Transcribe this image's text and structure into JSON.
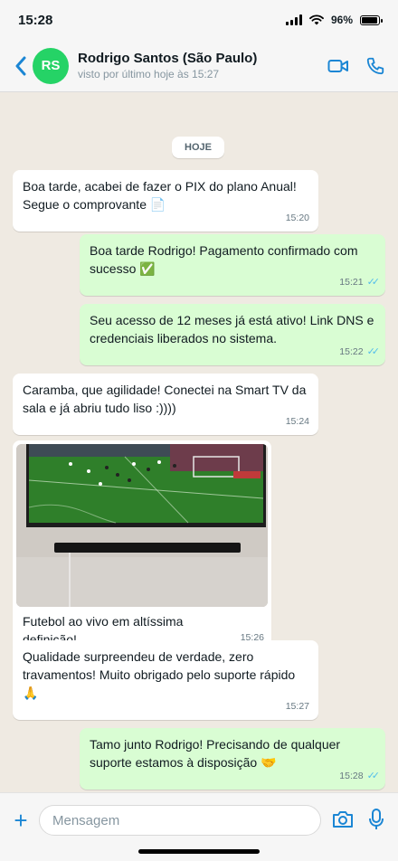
{
  "status": {
    "time": "15:28",
    "battery": "96%",
    "battery_level": 0.96
  },
  "header": {
    "avatar_initials": "RS",
    "contact_name": "Rodrigo Santos (São Paulo)",
    "contact_status": "visto por último hoje às 15:27",
    "accent": "#1b86d4"
  },
  "chat": {
    "date_label": "HOJE",
    "messages": [
      {
        "dir": "in",
        "text": "Boa tarde, acabei de fazer o PIX do plano Anual! Segue o comprovante 📄",
        "time": "15:20"
      },
      {
        "dir": "out",
        "text": "Boa tarde Rodrigo! Pagamento confirmado com sucesso ✅",
        "time": "15:21",
        "ticks": "✓✓"
      },
      {
        "dir": "out",
        "text": "Seu acesso de 12 meses já está ativo! Link DNS e credenciais liberados no sistema.",
        "time": "15:22",
        "ticks": "✓✓"
      },
      {
        "dir": "in",
        "text": "Caramba, que agilidade! Conectei na Smart TV da sala e já abriu tudo liso :))))",
        "time": "15:24"
      },
      {
        "dir": "in",
        "type": "image",
        "image_desc_icon": "tv-photo-icon",
        "text": "Futebol ao vivo em altíssima definição!",
        "time": "15:26"
      },
      {
        "dir": "in",
        "text": "Qualidade surpreendeu de verdade, zero travamentos! Muito obrigado pelo suporte rápido 🙏",
        "time": "15:27"
      },
      {
        "dir": "out",
        "text": "Tamo junto Rodrigo! Precisando de qualquer suporte estamos à disposição 🤝",
        "time": "15:28",
        "ticks": "✓✓"
      }
    ]
  },
  "input": {
    "placeholder": "Mensagem"
  },
  "colors": {
    "outgoing_bubble": "#d9fdd3",
    "incoming_bubble": "#ffffff",
    "background": "#efeae2",
    "read_ticks": "#53bdeb",
    "avatar": "#25d366"
  }
}
